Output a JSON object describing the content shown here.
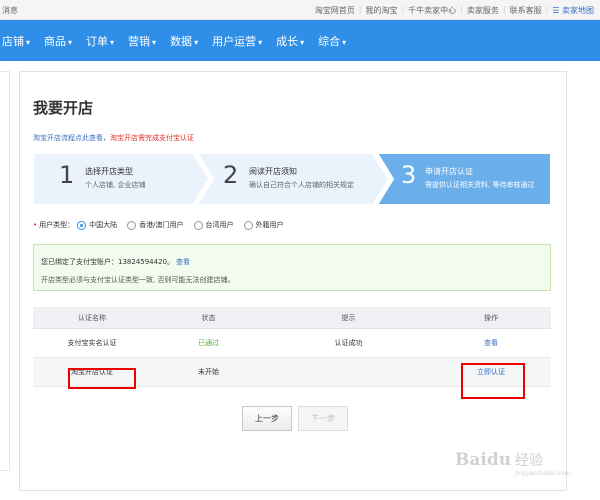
{
  "topbar": {
    "left_text": "消息",
    "links": [
      "淘宝网首页",
      "我的淘宝",
      "千牛卖家中心",
      "卖家服务",
      "联系客服"
    ],
    "map_label": "卖家地图"
  },
  "nav": {
    "items": [
      "店铺",
      "商品",
      "订单",
      "营销",
      "数据",
      "用户运营",
      "成长",
      "综合"
    ],
    "caret": "▾"
  },
  "page": {
    "title": "我要开店",
    "flow_tip_prefix": "淘宝开店流程点此查看，",
    "flow_tip_link": "淘宝开店需完成支付宝认证"
  },
  "steps": [
    {
      "num": "1",
      "title": "选择开店类型",
      "desc": "个人店铺, 企业店铺"
    },
    {
      "num": "2",
      "title": "阅读开店须知",
      "desc": "确认自己符合个人店铺的相关规定"
    },
    {
      "num": "3",
      "title": "申请开店认证",
      "desc": "需提供认证相关资料, 等待审核通过"
    }
  ],
  "user_type": {
    "label": "用户类型：",
    "options": [
      "中国大陆",
      "香港/澳门用户",
      "台湾用户",
      "外籍用户"
    ],
    "selected": "中国大陆"
  },
  "info": {
    "line1_prefix": "您已绑定了支付宝账户：13824594420。",
    "line1_link": "查看",
    "line2": "开店类型必须与支付宝认证类型一致, 否则可能无法创建店铺。"
  },
  "table": {
    "headers": [
      "认证名称",
      "状态",
      "提示",
      "操作"
    ],
    "rows": [
      {
        "name": "支付宝实名认证",
        "status": "已通过",
        "tip": "认证成功",
        "action": "查看"
      },
      {
        "name": "淘宝开店认证",
        "status": "未开始",
        "tip": "",
        "action": "立即认证"
      }
    ]
  },
  "buttons": {
    "prev": "上一步",
    "next": "下一步"
  },
  "watermark": {
    "brand": "Baidu",
    "sub": "经验",
    "url": "jingyan.baidu.com"
  },
  "colors": {
    "nav_blue": "#2f8fe8",
    "step_active": "#6aaeea",
    "step_inactive": "#eaf2fb",
    "success_green": "#5aa83c",
    "link_blue": "#3670c5",
    "highlight_red": "#ee0000"
  }
}
